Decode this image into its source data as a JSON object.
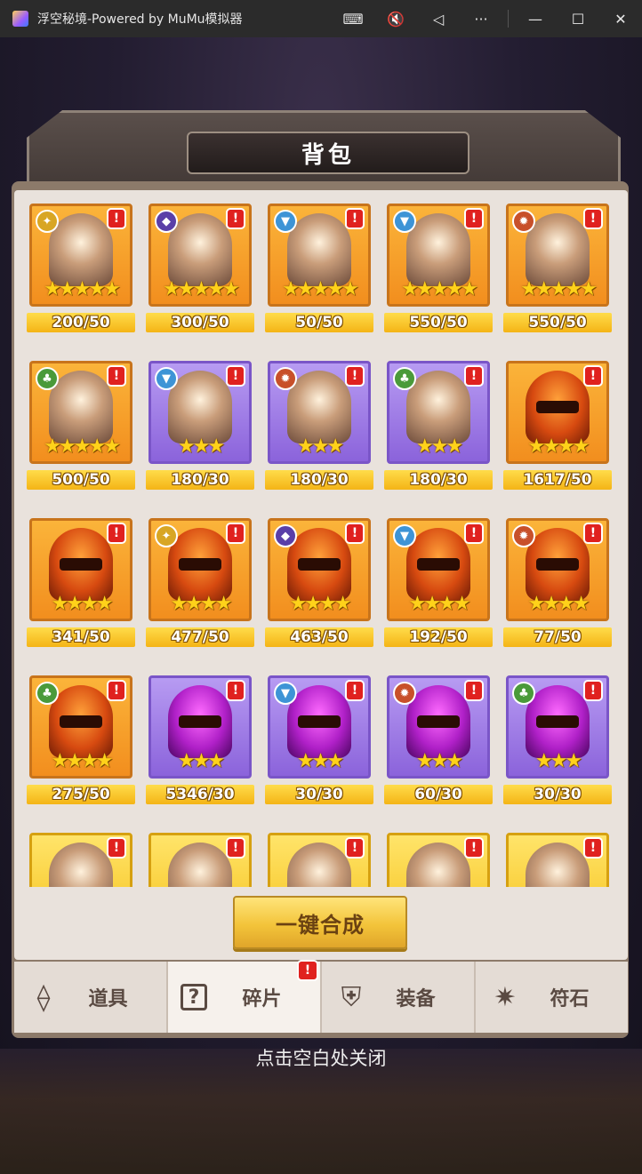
{
  "window": {
    "title": "浮空秘境-Powered by MuMu模拟器",
    "controls": {
      "keyboard": "⌨",
      "mute": "🔇",
      "back": "◁",
      "more": "···",
      "minimize": "—",
      "maximize": "☐",
      "close": "✕"
    }
  },
  "panel": {
    "title": "背包",
    "compose_label": "一键合成",
    "close_hint": "点击空白处关闭"
  },
  "items": [
    {
      "count": "200/50",
      "stars": "★★★★★",
      "alert": "!",
      "faction": "✦",
      "faction_type": "light",
      "frame": "orange",
      "art": "hero"
    },
    {
      "count": "300/50",
      "stars": "★★★★★",
      "alert": "!",
      "faction": "◆",
      "faction_type": "dark",
      "frame": "orange",
      "art": "hero"
    },
    {
      "count": "50/50",
      "stars": "★★★★★",
      "alert": "!",
      "faction": "▼",
      "faction_type": "water",
      "frame": "orange",
      "art": "hero"
    },
    {
      "count": "550/50",
      "stars": "★★★★★",
      "alert": "!",
      "faction": "▼",
      "faction_type": "water",
      "frame": "orange",
      "art": "hero"
    },
    {
      "count": "550/50",
      "stars": "★★★★★",
      "alert": "!",
      "faction": "✹",
      "faction_type": "fire",
      "frame": "orange",
      "art": "hero"
    },
    {
      "count": "500/50",
      "stars": "★★★★★",
      "alert": "!",
      "faction": "♣",
      "faction_type": "nature",
      "frame": "orange",
      "art": "hero"
    },
    {
      "count": "180/30",
      "stars": "★★★",
      "alert": "!",
      "faction": "▼",
      "faction_type": "water",
      "frame": "purple",
      "art": "hero"
    },
    {
      "count": "180/30",
      "stars": "★★★",
      "alert": "!",
      "faction": "✹",
      "faction_type": "fire",
      "frame": "purple",
      "art": "hero"
    },
    {
      "count": "180/30",
      "stars": "★★★",
      "alert": "!",
      "faction": "♣",
      "faction_type": "nature",
      "frame": "purple",
      "art": "hero"
    },
    {
      "count": "1617/50",
      "stars": "★★★★",
      "alert": "!",
      "faction": "",
      "faction_type": "",
      "frame": "orange",
      "art": "helmet-orange"
    },
    {
      "count": "341/50",
      "stars": "★★★★",
      "alert": "!",
      "faction": "",
      "faction_type": "",
      "frame": "orange",
      "art": "helmet-orange"
    },
    {
      "count": "477/50",
      "stars": "★★★★",
      "alert": "!",
      "faction": "✦",
      "faction_type": "light",
      "frame": "orange",
      "art": "helmet-orange"
    },
    {
      "count": "463/50",
      "stars": "★★★★",
      "alert": "!",
      "faction": "◆",
      "faction_type": "dark",
      "frame": "orange",
      "art": "helmet-orange"
    },
    {
      "count": "192/50",
      "stars": "★★★★",
      "alert": "!",
      "faction": "▼",
      "faction_type": "water",
      "frame": "orange",
      "art": "helmet-orange"
    },
    {
      "count": "77/50",
      "stars": "★★★★",
      "alert": "!",
      "faction": "✹",
      "faction_type": "fire",
      "frame": "orange",
      "art": "helmet-orange"
    },
    {
      "count": "275/50",
      "stars": "★★★★",
      "alert": "!",
      "faction": "♣",
      "faction_type": "nature",
      "frame": "orange",
      "art": "helmet-orange"
    },
    {
      "count": "5346/30",
      "stars": "★★★",
      "alert": "!",
      "faction": "",
      "faction_type": "",
      "frame": "purple",
      "art": "helmet-purple"
    },
    {
      "count": "30/30",
      "stars": "★★★",
      "alert": "!",
      "faction": "▼",
      "faction_type": "water",
      "frame": "purple",
      "art": "helmet-purple"
    },
    {
      "count": "60/30",
      "stars": "★★★",
      "alert": "!",
      "faction": "✹",
      "faction_type": "fire",
      "frame": "purple",
      "art": "helmet-purple"
    },
    {
      "count": "30/30",
      "stars": "★★★",
      "alert": "!",
      "faction": "♣",
      "faction_type": "nature",
      "frame": "purple",
      "art": "helmet-purple"
    },
    {
      "count": "",
      "stars": "",
      "alert": "!",
      "faction": "",
      "faction_type": "",
      "frame": "gold",
      "art": "hero"
    },
    {
      "count": "",
      "stars": "",
      "alert": "!",
      "faction": "",
      "faction_type": "",
      "frame": "gold",
      "art": "hero"
    },
    {
      "count": "",
      "stars": "",
      "alert": "!",
      "faction": "",
      "faction_type": "",
      "frame": "gold",
      "art": "hero"
    },
    {
      "count": "",
      "stars": "",
      "alert": "!",
      "faction": "",
      "faction_type": "",
      "frame": "gold",
      "art": "hero"
    },
    {
      "count": "",
      "stars": "",
      "alert": "!",
      "faction": "",
      "faction_type": "",
      "frame": "gold",
      "art": "hero"
    }
  ],
  "tabs": [
    {
      "label": "道具",
      "icon": "⟠",
      "icon_name": "item-bag-icon",
      "active": false,
      "alert": ""
    },
    {
      "label": "碎片",
      "icon": "?",
      "icon_name": "shard-question-icon",
      "active": true,
      "alert": "!"
    },
    {
      "label": "装备",
      "icon": "⛨",
      "icon_name": "shield-icon",
      "active": false,
      "alert": ""
    },
    {
      "label": "符石",
      "icon": "✷",
      "icon_name": "rune-icon",
      "active": false,
      "alert": ""
    }
  ]
}
